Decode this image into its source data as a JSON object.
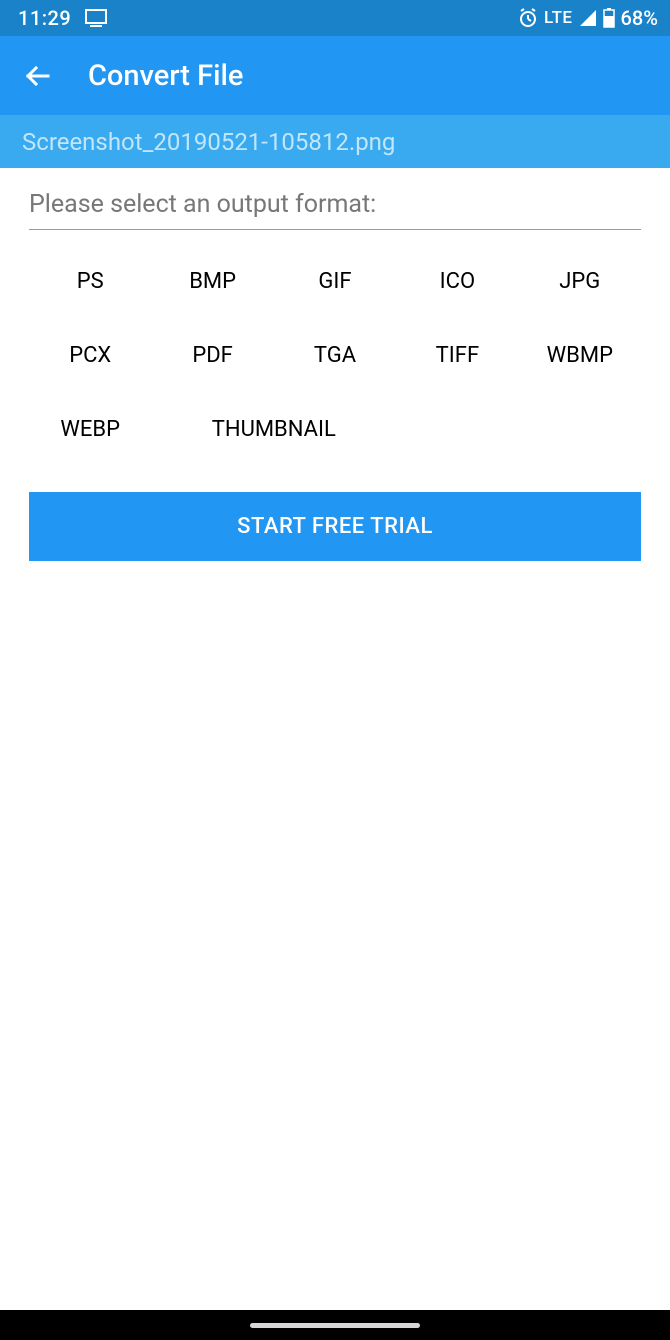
{
  "status": {
    "time": "11:29",
    "lte": "LTE",
    "battery": "68%"
  },
  "appbar": {
    "title": "Convert File"
  },
  "file": {
    "name": "Screenshot_20190521-105812.png"
  },
  "prompt": "Please select an output format:",
  "formats": [
    "PS",
    "BMP",
    "GIF",
    "ICO",
    "JPG",
    "PCX",
    "PDF",
    "TGA",
    "TIFF",
    "WBMP",
    "WEBP",
    "THUMBNAIL"
  ],
  "cta": "START FREE TRIAL"
}
